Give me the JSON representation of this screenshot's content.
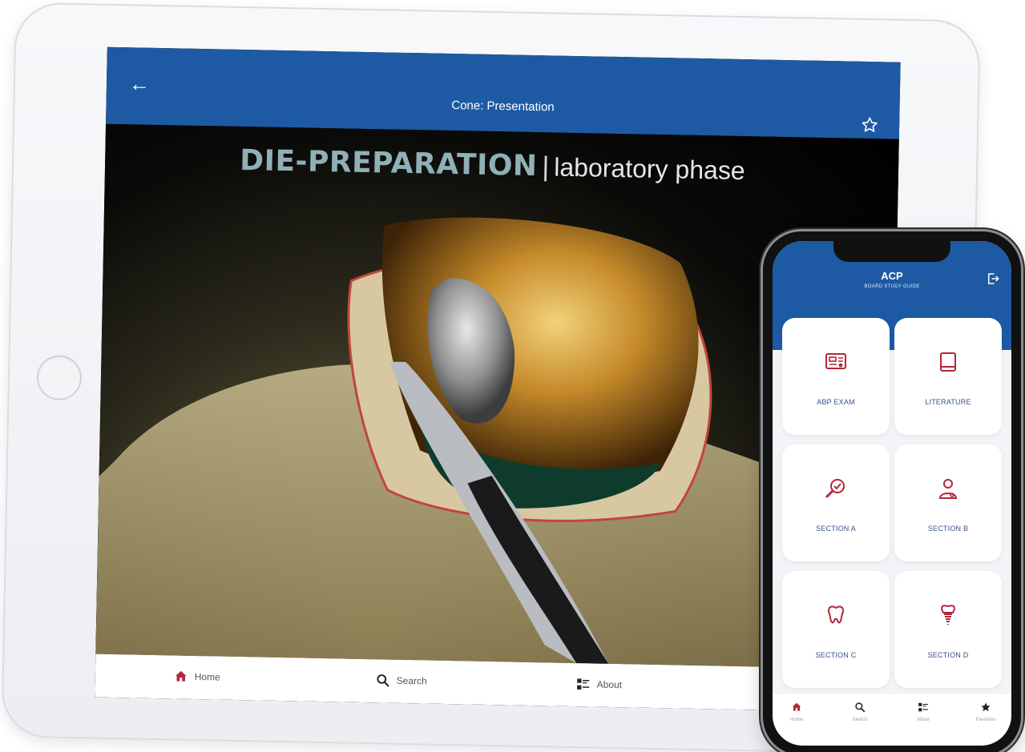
{
  "tablet": {
    "header": {
      "back_icon": "arrow-left-icon",
      "title": "Cone: Presentation",
      "favorite_icon": "star-outline-icon",
      "color": "#1d5aa3"
    },
    "slide": {
      "title_strong": "DIE-PREPARATION",
      "separator": "|",
      "title_light": "laboratory phase"
    },
    "tabbar": [
      {
        "label": "Home",
        "icon": "home-icon",
        "active": true
      },
      {
        "label": "Search",
        "icon": "search-icon",
        "active": false
      },
      {
        "label": "About",
        "icon": "list-icon",
        "active": false
      }
    ]
  },
  "phone": {
    "header": {
      "title": "ACP",
      "subtitle": "BOARD STUDY GUIDE",
      "logout_icon": "logout-icon",
      "color": "#1d5aa3"
    },
    "cards": [
      {
        "label": "ABP EXAM",
        "icon": "certificate-icon"
      },
      {
        "label": "LITERATURE",
        "icon": "book-icon"
      },
      {
        "label": "SECTION A",
        "icon": "magnifier-check-icon"
      },
      {
        "label": "SECTION B",
        "icon": "doctor-icon"
      },
      {
        "label": "SECTION C",
        "icon": "tooth-icon"
      },
      {
        "label": "SECTION D",
        "icon": "implant-icon"
      }
    ],
    "tabbar": [
      {
        "label": "Home",
        "icon": "home-icon",
        "active": true
      },
      {
        "label": "Search",
        "icon": "search-icon",
        "active": false
      },
      {
        "label": "About",
        "icon": "list-icon",
        "active": false
      },
      {
        "label": "Favorites",
        "icon": "star-icon",
        "active": false
      }
    ]
  },
  "colors": {
    "brand_blue": "#1d5aa3",
    "accent_red": "#b3263c",
    "card_label": "#3a4f8a"
  }
}
